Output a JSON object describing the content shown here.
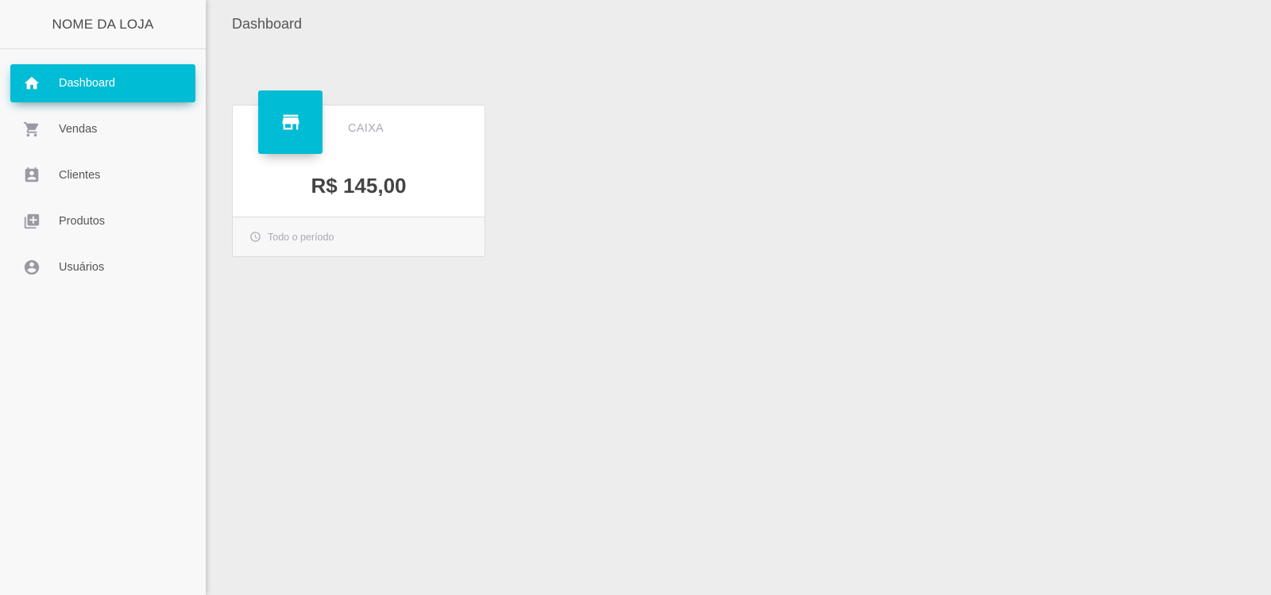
{
  "brand": {
    "name": "NOME DA LOJA"
  },
  "sidebar": {
    "items": [
      {
        "label": "Dashboard",
        "icon": "home-icon",
        "active": true
      },
      {
        "label": "Vendas",
        "icon": "cart-icon",
        "active": false
      },
      {
        "label": "Clientes",
        "icon": "contact-card-icon",
        "active": false
      },
      {
        "label": "Produtos",
        "icon": "library-books-icon",
        "active": false
      },
      {
        "label": "Usuários",
        "icon": "account-circle-icon",
        "active": false
      }
    ]
  },
  "header": {
    "title": "Dashboard"
  },
  "card": {
    "icon": "store-icon",
    "category": "CAIXA",
    "value": "R$ 145,00",
    "footer_icon": "clock-icon",
    "footer_text": "Todo o período"
  },
  "colors": {
    "accent": "#00bcd4",
    "sidebar_bg": "#f9f8f8",
    "main_bg": "#ededed",
    "muted_text": "#a9aab3",
    "icon_gray": "#999aa3"
  }
}
